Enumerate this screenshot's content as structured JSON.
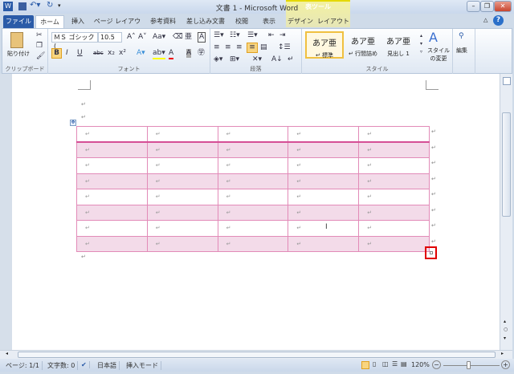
{
  "window": {
    "title": "文書 1 - Microsoft Word",
    "context_tab_group": "表ツール",
    "minimize": "–",
    "restore": "❐",
    "close": "✕"
  },
  "tabs": [
    {
      "label": "ファイル"
    },
    {
      "label": "ホーム"
    },
    {
      "label": "挿入"
    },
    {
      "label": "ページ レイアウト"
    },
    {
      "label": "参考資料"
    },
    {
      "label": "差し込み文書"
    },
    {
      "label": "校閲"
    },
    {
      "label": "表示"
    },
    {
      "label": "デザイン"
    },
    {
      "label": "レイアウト"
    }
  ],
  "ribbon": {
    "clipboard": {
      "label": "クリップボード",
      "paste": "貼り付け"
    },
    "font": {
      "label": "フォント",
      "font_name": "ＭＳ ゴシック (",
      "font_size": "10.5",
      "bold": "B",
      "italic": "I",
      "underline": "U",
      "strike": "abc",
      "sub": "x₂",
      "sup": "x²"
    },
    "paragraph": {
      "label": "段落"
    },
    "styles": {
      "label": "スタイル",
      "items": [
        {
          "preview": "あア亜",
          "name": "↵ 標準"
        },
        {
          "preview": "あア亜",
          "name": "↵ 行間詰め"
        },
        {
          "preview": "あア亜",
          "name": "見出し 1"
        }
      ],
      "change": "スタイルの変更"
    },
    "editing": {
      "label": "編集"
    }
  },
  "table": {
    "rows": 8,
    "cols": 5,
    "cell_mark": "↵",
    "border_color": "#e28bb8",
    "band_color": "#f3dbe9"
  },
  "status": {
    "page": "ページ: 1/1",
    "words": "文字数: 0",
    "language": "日本語",
    "mode": "挿入モード",
    "zoom": "120%"
  }
}
